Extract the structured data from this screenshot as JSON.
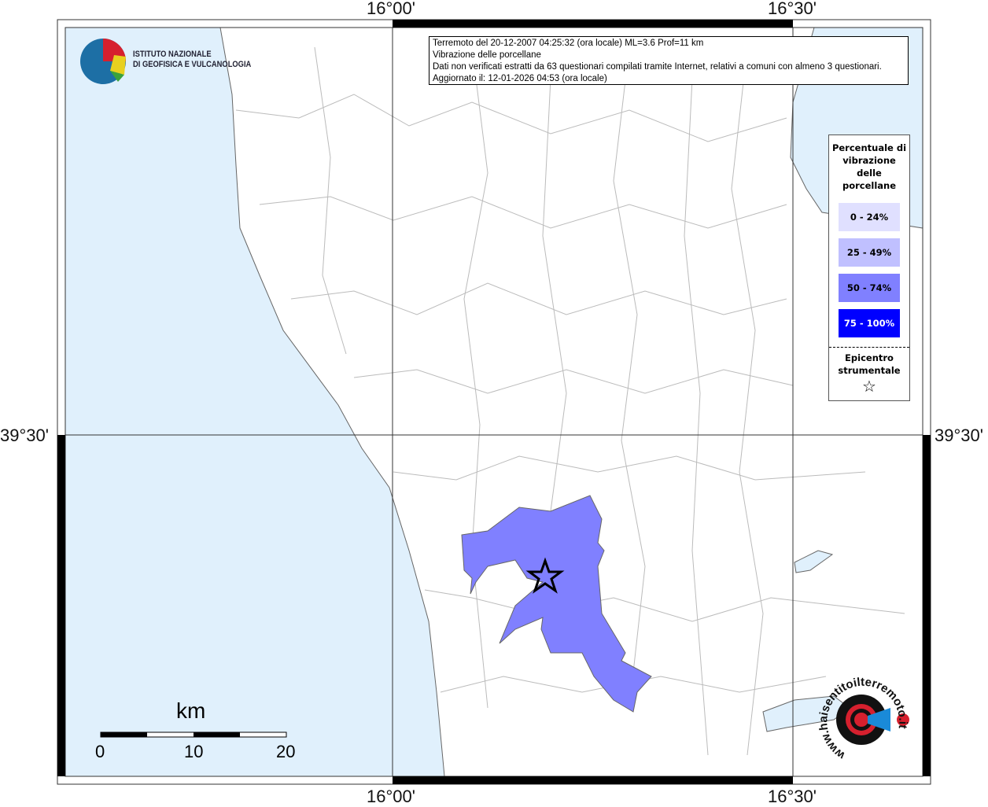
{
  "grid_labels": {
    "lon_left": "16°00'",
    "lon_right": "16°30'",
    "lat": "39°30'"
  },
  "info": {
    "line1": "Terremoto del 20-12-2007 04:25:32 (ora locale) ML=3.6 Prof=11 km",
    "line2": "Vibrazione delle porcellane",
    "line3": "Dati non verificati estratti da 63 questionari compilati tramite Internet, relativi a comuni con almeno 3 questionari.",
    "line4": "Aggiornato il: 12-01-2026 04:53 (ora locale)"
  },
  "logo": {
    "line1": "ISTITUTO NAZIONALE",
    "line2": "DI GEOFISICA E VULCANOLOGIA"
  },
  "legend": {
    "title": "Percentuale di vibrazione delle porcellane",
    "classes": [
      {
        "label": "0 - 24%",
        "color": "#e0e0ff"
      },
      {
        "label": "25 - 49%",
        "color": "#c0c0ff"
      },
      {
        "label": "50 - 74%",
        "color": "#8080ff"
      },
      {
        "label": "75 - 100%",
        "color": "#0000ff"
      }
    ],
    "epicenter_label": "Epicentro strumentale"
  },
  "scale": {
    "unit": "km",
    "ticks": [
      "0",
      "10",
      "20"
    ]
  },
  "watermark": "www.haisentitoilterremoto.it",
  "colors": {
    "sea": "#e0f0fc",
    "affected": "#8080ff"
  }
}
